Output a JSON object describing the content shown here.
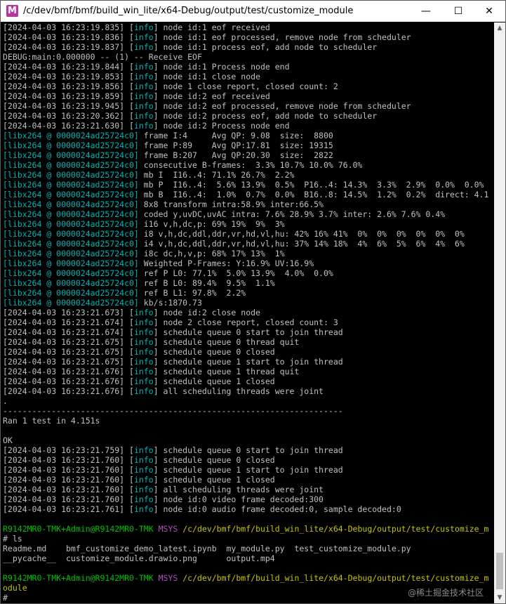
{
  "window": {
    "title": "/c/dev/bmf/bmf/build_win_lite/x64-Debug/output/test/customize_module",
    "app_icon": "M",
    "minimize_glyph": "—",
    "maximize_glyph": "☐",
    "close_glyph": "✕"
  },
  "colors": {
    "background": "#000000",
    "text": "#c0c0c0",
    "info_tag": "#00b4b4",
    "libx264_tag": "#00b4b4",
    "prompt_user": "#00c200",
    "prompt_msys": "#b84ebc",
    "prompt_path": "#c7c400"
  },
  "terminal": {
    "lines": [
      [
        {
          "c": "text",
          "t": "[2024-04-03 16:23:19.835] ["
        },
        {
          "c": "info",
          "t": "info"
        },
        {
          "c": "text",
          "t": "] node id:1 eof received"
        }
      ],
      [
        {
          "c": "text",
          "t": "[2024-04-03 16:23:19.836] ["
        },
        {
          "c": "info",
          "t": "info"
        },
        {
          "c": "text",
          "t": "] node id:1 eof processed, remove node from scheduler"
        }
      ],
      [
        {
          "c": "text",
          "t": "[2024-04-03 16:23:19.837] ["
        },
        {
          "c": "info",
          "t": "info"
        },
        {
          "c": "text",
          "t": "] node id:1 process eof, add node to scheduler"
        }
      ],
      [
        {
          "c": "text",
          "t": "DEBUG:main:0.000000 -- (1) -- Receive EOF"
        }
      ],
      [
        {
          "c": "text",
          "t": "[2024-04-03 16:23:19.844] ["
        },
        {
          "c": "info",
          "t": "info"
        },
        {
          "c": "text",
          "t": "] node id:1 Process node end"
        }
      ],
      [
        {
          "c": "text",
          "t": "[2024-04-03 16:23:19.853] ["
        },
        {
          "c": "info",
          "t": "info"
        },
        {
          "c": "text",
          "t": "] node id:1 close node"
        }
      ],
      [
        {
          "c": "text",
          "t": "[2024-04-03 16:23:19.856] ["
        },
        {
          "c": "info",
          "t": "info"
        },
        {
          "c": "text",
          "t": "] node 1 close report, closed count: 2"
        }
      ],
      [
        {
          "c": "text",
          "t": "[2024-04-03 16:23:19.859] ["
        },
        {
          "c": "info",
          "t": "info"
        },
        {
          "c": "text",
          "t": "] node id:2 eof received"
        }
      ],
      [
        {
          "c": "text",
          "t": "[2024-04-03 16:23:19.945] ["
        },
        {
          "c": "info",
          "t": "info"
        },
        {
          "c": "text",
          "t": "] node id:2 eof processed, remove node from scheduler"
        }
      ],
      [
        {
          "c": "text",
          "t": "[2024-04-03 16:23:20.362] ["
        },
        {
          "c": "info",
          "t": "info"
        },
        {
          "c": "text",
          "t": "] node id:2 process eof, add node to scheduler"
        }
      ],
      [
        {
          "c": "text",
          "t": "[2024-04-03 16:23:21.630] ["
        },
        {
          "c": "info",
          "t": "info"
        },
        {
          "c": "text",
          "t": "] node id:2 Process node end"
        }
      ],
      [
        {
          "c": "libx",
          "t": "[libx264 @ 0000024ad25724c0]"
        },
        {
          "c": "text",
          "t": " frame I:4     Avg QP: 9.08  size:  8800"
        }
      ],
      [
        {
          "c": "libx",
          "t": "[libx264 @ 0000024ad25724c0]"
        },
        {
          "c": "text",
          "t": " frame P:89    Avg QP:17.81  size: 19315"
        }
      ],
      [
        {
          "c": "libx",
          "t": "[libx264 @ 0000024ad25724c0]"
        },
        {
          "c": "text",
          "t": " frame B:207   Avg QP:20.30  size:  2822"
        }
      ],
      [
        {
          "c": "libx",
          "t": "[libx264 @ 0000024ad25724c0]"
        },
        {
          "c": "text",
          "t": " consecutive B-frames:  3.3% 10.7% 10.0% 76.0%"
        }
      ],
      [
        {
          "c": "libx",
          "t": "[libx264 @ 0000024ad25724c0]"
        },
        {
          "c": "text",
          "t": " mb I  I16..4: 71.1% 26.7%  2.2%"
        }
      ],
      [
        {
          "c": "libx",
          "t": "[libx264 @ 0000024ad25724c0]"
        },
        {
          "c": "text",
          "t": " mb P  I16..4:  5.6% 13.9%  0.5%  P16..4: 14.3%  3.3%  2.9%  0.0%  0.0%"
        }
      ],
      [
        {
          "c": "libx",
          "t": "[libx264 @ 0000024ad25724c0]"
        },
        {
          "c": "text",
          "t": " mb B  I16..4:  1.0%  0.7%  0.0%  B16..8: 14.5%  1.2%  0.2%  direct: 4.1"
        }
      ],
      [
        {
          "c": "libx",
          "t": "[libx264 @ 0000024ad25724c0]"
        },
        {
          "c": "text",
          "t": " 8x8 transform intra:58.9% inter:66.5%"
        }
      ],
      [
        {
          "c": "libx",
          "t": "[libx264 @ 0000024ad25724c0]"
        },
        {
          "c": "text",
          "t": " coded y,uvDC,uvAC intra: 7.6% 28.9% 3.7% inter: 2.6% 7.6% 0.4%"
        }
      ],
      [
        {
          "c": "libx",
          "t": "[libx264 @ 0000024ad25724c0]"
        },
        {
          "c": "text",
          "t": " i16 v,h,dc,p: 69% 19%  9%  3%"
        }
      ],
      [
        {
          "c": "libx",
          "t": "[libx264 @ 0000024ad25724c0]"
        },
        {
          "c": "text",
          "t": " i8 v,h,dc,ddl,ddr,vr,hd,vl,hu: 42% 16% 41%  0%  0%  0%  0%  0%  0%"
        }
      ],
      [
        {
          "c": "libx",
          "t": "[libx264 @ 0000024ad25724c0]"
        },
        {
          "c": "text",
          "t": " i4 v,h,dc,ddl,ddr,vr,hd,vl,hu: 37% 14% 18%  4%  6%  5%  6%  4%  6%"
        }
      ],
      [
        {
          "c": "libx",
          "t": "[libx264 @ 0000024ad25724c0]"
        },
        {
          "c": "text",
          "t": " i8c dc,h,v,p: 68% 17% 13%  1%"
        }
      ],
      [
        {
          "c": "libx",
          "t": "[libx264 @ 0000024ad25724c0]"
        },
        {
          "c": "text",
          "t": " Weighted P-Frames: Y:16.9% UV:16.9%"
        }
      ],
      [
        {
          "c": "libx",
          "t": "[libx264 @ 0000024ad25724c0]"
        },
        {
          "c": "text",
          "t": " ref P L0: 77.1%  5.0% 13.9%  4.0%  0.0%"
        }
      ],
      [
        {
          "c": "libx",
          "t": "[libx264 @ 0000024ad25724c0]"
        },
        {
          "c": "text",
          "t": " ref B L0: 89.4%  9.5%  1.1%"
        }
      ],
      [
        {
          "c": "libx",
          "t": "[libx264 @ 0000024ad25724c0]"
        },
        {
          "c": "text",
          "t": " ref B L1: 97.8%  2.2%"
        }
      ],
      [
        {
          "c": "libx",
          "t": "[libx264 @ 0000024ad25724c0]"
        },
        {
          "c": "text",
          "t": " kb/s:1870.73"
        }
      ],
      [
        {
          "c": "text",
          "t": "[2024-04-03 16:23:21.673] ["
        },
        {
          "c": "info",
          "t": "info"
        },
        {
          "c": "text",
          "t": "] node id:2 close node"
        }
      ],
      [
        {
          "c": "text",
          "t": "[2024-04-03 16:23:21.674] ["
        },
        {
          "c": "info",
          "t": "info"
        },
        {
          "c": "text",
          "t": "] node 2 close report, closed count: 3"
        }
      ],
      [
        {
          "c": "text",
          "t": "[2024-04-03 16:23:21.674] ["
        },
        {
          "c": "info",
          "t": "info"
        },
        {
          "c": "text",
          "t": "] schedule queue 0 start to join thread"
        }
      ],
      [
        {
          "c": "text",
          "t": "[2024-04-03 16:23:21.675] ["
        },
        {
          "c": "info",
          "t": "info"
        },
        {
          "c": "text",
          "t": "] schedule queue 0 thread quit"
        }
      ],
      [
        {
          "c": "text",
          "t": "[2024-04-03 16:23:21.675] ["
        },
        {
          "c": "info",
          "t": "info"
        },
        {
          "c": "text",
          "t": "] schedule queue 0 closed"
        }
      ],
      [
        {
          "c": "text",
          "t": "[2024-04-03 16:23:21.675] ["
        },
        {
          "c": "info",
          "t": "info"
        },
        {
          "c": "text",
          "t": "] schedule queue 1 start to join thread"
        }
      ],
      [
        {
          "c": "text",
          "t": "[2024-04-03 16:23:21.676] ["
        },
        {
          "c": "info",
          "t": "info"
        },
        {
          "c": "text",
          "t": "] schedule queue 1 thread quit"
        }
      ],
      [
        {
          "c": "text",
          "t": "[2024-04-03 16:23:21.676] ["
        },
        {
          "c": "info",
          "t": "info"
        },
        {
          "c": "text",
          "t": "] schedule queue 1 closed"
        }
      ],
      [
        {
          "c": "text",
          "t": "[2024-04-03 16:23:21.676] ["
        },
        {
          "c": "info",
          "t": "info"
        },
        {
          "c": "text",
          "t": "] all scheduling threads were joint"
        }
      ],
      [
        {
          "c": "text",
          "t": "."
        }
      ],
      [
        {
          "c": "text",
          "t": "----------------------------------------------------------------------"
        }
      ],
      [
        {
          "c": "text",
          "t": "Ran 1 test in 4.151s"
        }
      ],
      [
        {
          "c": "text",
          "t": ""
        }
      ],
      [
        {
          "c": "text",
          "t": "OK"
        }
      ],
      [
        {
          "c": "text",
          "t": "[2024-04-03 16:23:21.759] ["
        },
        {
          "c": "info",
          "t": "info"
        },
        {
          "c": "text",
          "t": "] schedule queue 0 start to join thread"
        }
      ],
      [
        {
          "c": "text",
          "t": "[2024-04-03 16:23:21.760] ["
        },
        {
          "c": "info",
          "t": "info"
        },
        {
          "c": "text",
          "t": "] schedule queue 0 closed"
        }
      ],
      [
        {
          "c": "text",
          "t": "[2024-04-03 16:23:21.760] ["
        },
        {
          "c": "info",
          "t": "info"
        },
        {
          "c": "text",
          "t": "] schedule queue 1 start to join thread"
        }
      ],
      [
        {
          "c": "text",
          "t": "[2024-04-03 16:23:21.760] ["
        },
        {
          "c": "info",
          "t": "info"
        },
        {
          "c": "text",
          "t": "] schedule queue 1 closed"
        }
      ],
      [
        {
          "c": "text",
          "t": "[2024-04-03 16:23:21.760] ["
        },
        {
          "c": "info",
          "t": "info"
        },
        {
          "c": "text",
          "t": "] all scheduling threads were joint"
        }
      ],
      [
        {
          "c": "text",
          "t": "[2024-04-03 16:23:21.760] ["
        },
        {
          "c": "info",
          "t": "info"
        },
        {
          "c": "text",
          "t": "] node id:0 video frame decoded:300"
        }
      ],
      [
        {
          "c": "text",
          "t": "[2024-04-03 16:23:21.761] ["
        },
        {
          "c": "info",
          "t": "info"
        },
        {
          "c": "text",
          "t": "] node id:0 audio frame decoded:0, sample decoded:0"
        }
      ],
      [
        {
          "c": "text",
          "t": ""
        }
      ],
      [
        {
          "c": "user",
          "t": "R9142MR0-TMK+Admin@R9142MR0-TMK"
        },
        {
          "c": "text",
          "t": " "
        },
        {
          "c": "msys",
          "t": "MSYS"
        },
        {
          "c": "text",
          "t": " "
        },
        {
          "c": "path",
          "t": "/c/dev/bmf/bmf/build_win_lite/x64-Debug/output/test/customize_m"
        }
      ],
      [
        {
          "c": "text",
          "t": "# ls"
        }
      ],
      [
        {
          "c": "text",
          "t": "Readme.md    bmf_customize_demo_latest.ipynb  my_module.py  test_customize_module.py"
        }
      ],
      [
        {
          "c": "text",
          "t": "__pycache__  customize_module.drawio.png      output.mp4"
        }
      ],
      [
        {
          "c": "text",
          "t": ""
        }
      ],
      [
        {
          "c": "user",
          "t": "R9142MR0-TMK+Admin@R9142MR0-TMK"
        },
        {
          "c": "text",
          "t": " "
        },
        {
          "c": "msys",
          "t": "MSYS"
        },
        {
          "c": "text",
          "t": " "
        },
        {
          "c": "path",
          "t": "/c/dev/bmf/bmf/build_win_lite/x64-Debug/output/test/customize_m"
        }
      ],
      [
        {
          "c": "path",
          "t": "odule"
        }
      ],
      [
        {
          "c": "text",
          "t": "#"
        }
      ]
    ]
  },
  "watermark": "@稀土掘金技术社区"
}
